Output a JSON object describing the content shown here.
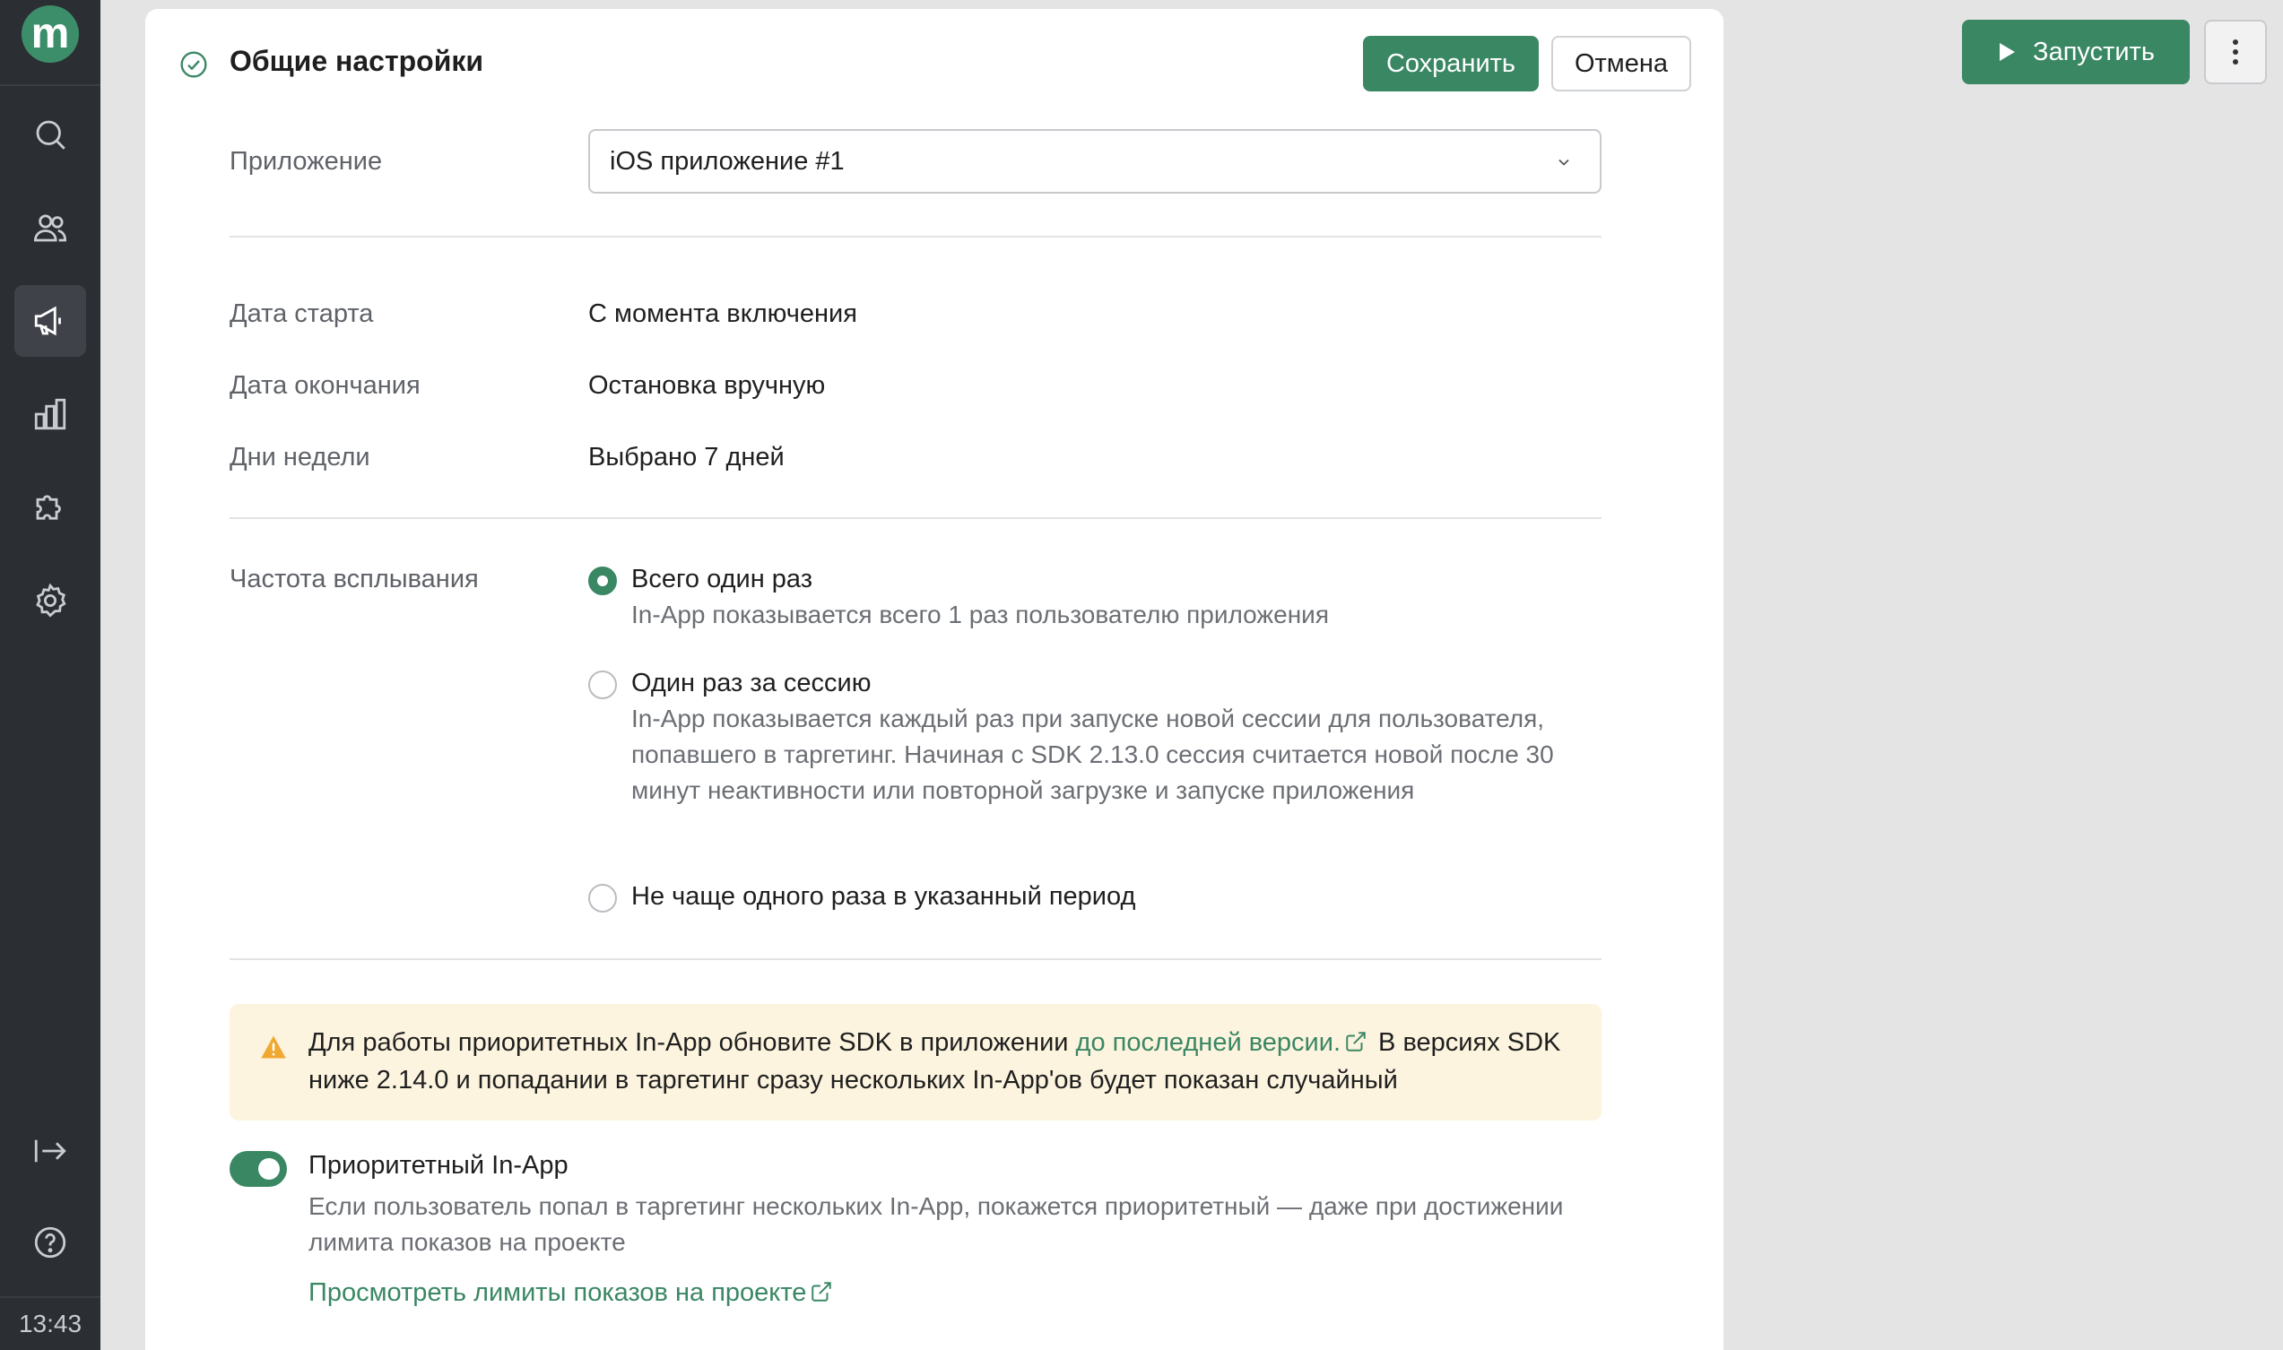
{
  "sidebar": {
    "logo": "m",
    "nav": [
      {
        "name": "search-icon"
      },
      {
        "name": "users-icon"
      },
      {
        "name": "megaphone-icon",
        "active": true
      },
      {
        "name": "chart-icon"
      },
      {
        "name": "puzzle-icon"
      },
      {
        "name": "gear-icon"
      }
    ],
    "bottom": [
      {
        "name": "logout-icon"
      },
      {
        "name": "help-icon"
      }
    ],
    "clock": "13:43"
  },
  "header": {
    "title": "Общие настройки",
    "save_label": "Сохранить",
    "cancel_label": "Отмена"
  },
  "app": {
    "label": "Приложение",
    "selected": "iOS приложение #1"
  },
  "schedule": {
    "start_label": "Дата старта",
    "start_value": "С момента включения",
    "end_label": "Дата окончания",
    "end_value": "Остановка вручную",
    "days_label": "Дни недели",
    "days_value": "Выбрано 7 дней"
  },
  "frequency": {
    "label": "Частота всплывания",
    "options": [
      {
        "title": "Всего один раз",
        "desc": "In-App показывается всего 1 раз пользователю приложения",
        "checked": true
      },
      {
        "title": "Один раз за сессию",
        "desc": "In-App показывается каждый раз при запуске новой сессии для пользователя, попавшего в таргетинг. Начиная с SDK 2.13.0 сессия считается новой после 30 минут неактивности или повторной загрузке и запуске приложения",
        "checked": false
      },
      {
        "title": "Не чаще одного раза в указанный период",
        "checked": false
      }
    ]
  },
  "alert": {
    "text_before": "Для работы приоритетных In-App обновите SDK в приложении ",
    "link": "до последней версии.",
    "text_after": " В версиях SDK ниже 2.14.0 и попадании в таргетинг сразу нескольких In-App'ов будет показан случайный"
  },
  "priority": {
    "enabled": true,
    "title": "Приоритетный In-App",
    "desc": "Если пользователь попал в таргетинг нескольких In-App, покажется приоритетный — даже при достижении лимита показов на проекте",
    "link": "Просмотреть лимиты показов на проекте"
  },
  "actions": {
    "run_label": "Запустить"
  },
  "colors": {
    "accent": "#3a8764",
    "sidebar": "#2b2e33",
    "alert_bg": "#fdf4df",
    "warning": "#f0a830"
  }
}
